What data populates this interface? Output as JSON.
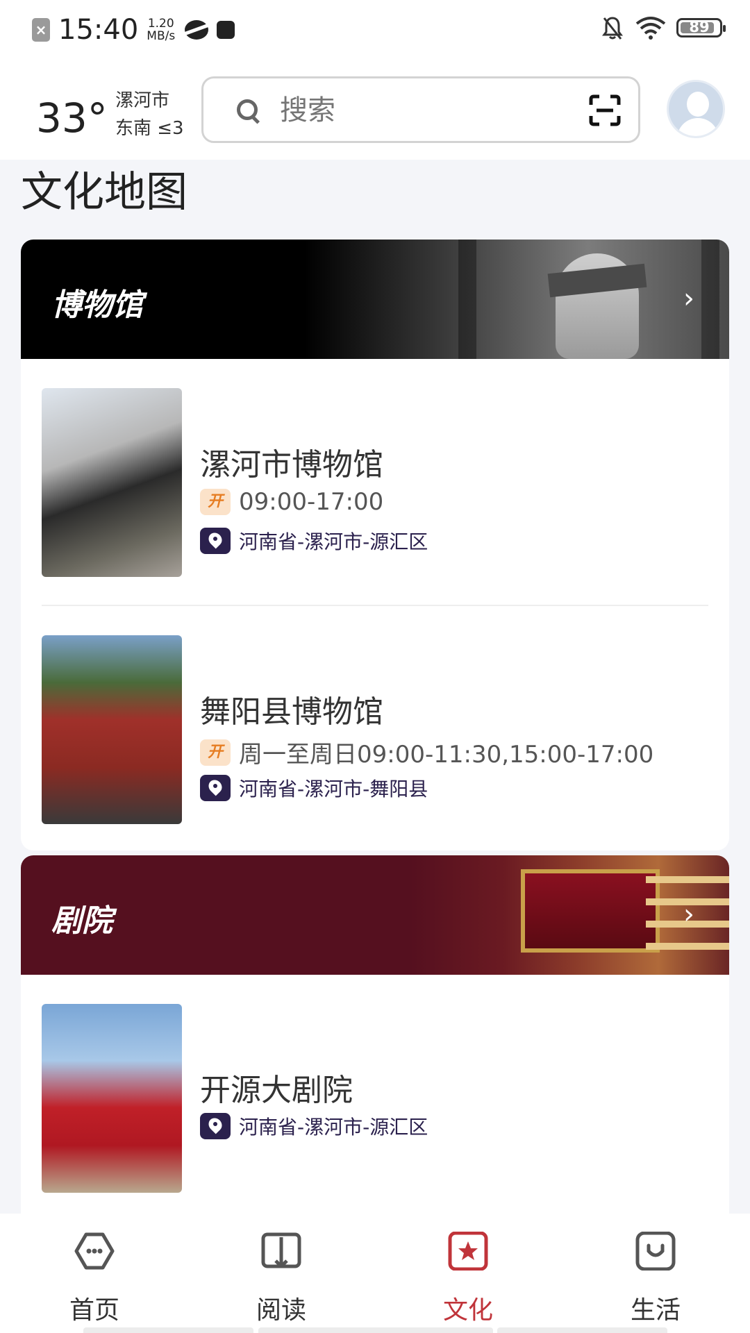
{
  "status_bar": {
    "time": "15:40",
    "net_speed_value": "1.20",
    "net_speed_unit": "MB/s",
    "battery": "89"
  },
  "header": {
    "temperature": "33°",
    "city": "漯河市",
    "wind": "东南 ≤3",
    "search_placeholder": "搜索"
  },
  "page": {
    "title": "文化地图"
  },
  "museums": {
    "banner_title": "博物馆",
    "items": [
      {
        "name": "漯河市博物馆",
        "badge": "开",
        "hours": "09:00-17:00",
        "address": "河南省-漯河市-源汇区"
      },
      {
        "name": "舞阳县博物馆",
        "badge": "开",
        "hours": "周一至周日09:00-11:30,15:00-17:00",
        "address": "河南省-漯河市-舞阳县"
      }
    ]
  },
  "theaters": {
    "banner_title": "剧院",
    "items": [
      {
        "name": "开源大剧院",
        "address": "河南省-漯河市-源汇区"
      }
    ]
  },
  "tabs": [
    {
      "label": "首页",
      "icon": "home-icon"
    },
    {
      "label": "阅读",
      "icon": "book-icon"
    },
    {
      "label": "文化",
      "icon": "culture-star-icon",
      "active": true
    },
    {
      "label": "生活",
      "icon": "life-bag-icon"
    }
  ],
  "colors": {
    "accent": "#c0343a",
    "museum_banner": "#000000",
    "theater_banner": "#55101f",
    "location_badge": "#2b214d",
    "open_badge_text": "#e67d22"
  }
}
